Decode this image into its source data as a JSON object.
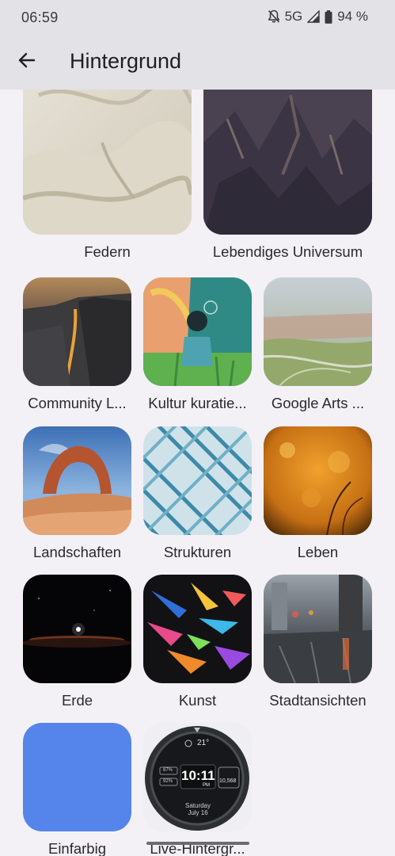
{
  "status_bar": {
    "time": "06:59",
    "network": "5G",
    "battery": "94 %",
    "icons": [
      "bell-off-icon",
      "signal-icon",
      "battery-icon"
    ]
  },
  "app_bar": {
    "title": "Hintergrund",
    "back_icon": "arrow-back-icon"
  },
  "categories": [
    {
      "label": "Federn"
    },
    {
      "label": "Lebendiges Universum"
    },
    {
      "label": "Community L..."
    },
    {
      "label": "Kultur kuratie..."
    },
    {
      "label": "Google Arts ..."
    },
    {
      "label": "Landschaften"
    },
    {
      "label": "Strukturen"
    },
    {
      "label": "Leben"
    },
    {
      "label": "Erde"
    },
    {
      "label": "Kunst"
    },
    {
      "label": "Stadtansichten"
    },
    {
      "label": "Einfarbig"
    },
    {
      "label": "Live-Hintergr..."
    }
  ],
  "watch_face": {
    "temperature": "21°",
    "time": "10:11",
    "ampm": "PM",
    "steps": "10,568",
    "stat_1": "87%",
    "stat_2": "92%",
    "day": "Saturday",
    "date": "July 16"
  },
  "colors": {
    "app_bar": "#e3e2e7",
    "background": "#f3f0f6",
    "solid_color_tile": "#5585ea"
  }
}
